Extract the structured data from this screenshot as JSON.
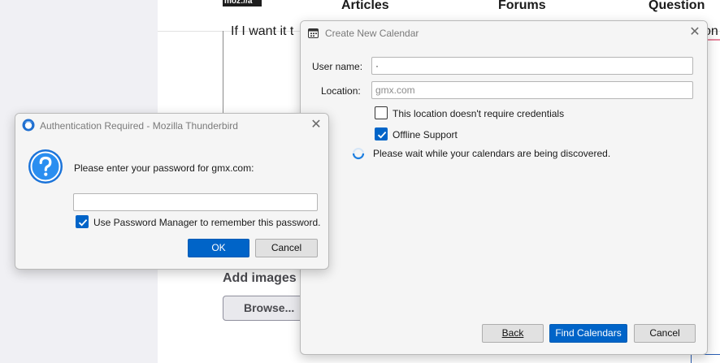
{
  "background": {
    "logo_text": "moz://a",
    "nav": [
      "Articles",
      "Forums",
      "Question"
    ],
    "text_fragment": "If I want it t",
    "text_fragment_right": "on",
    "add_images_label": "Add images",
    "browse_label": "Browse..."
  },
  "calendar_dialog": {
    "title": "Create New Calendar",
    "username_label": "User name:",
    "username_value": "·",
    "location_label": "Location:",
    "location_placeholder": "gmx.com",
    "no_credentials_label": "This location doesn't require credentials",
    "no_credentials_checked": false,
    "offline_label": "Offline Support",
    "offline_checked": true,
    "status_text": "Please wait while your calendars are being discovered.",
    "back_label": "Back",
    "find_label": "Find Calendars",
    "cancel_label": "Cancel"
  },
  "auth_dialog": {
    "title": "Authentication Required - Mozilla Thunderbird",
    "prompt": "Please enter your password for gmx.com:",
    "password_value": "",
    "remember_label": "Use Password Manager to remember this password.",
    "remember_checked": true,
    "ok_label": "OK",
    "cancel_label": "Cancel"
  },
  "colors": {
    "accent": "#0064c8",
    "info_icon": "#1e88e5"
  }
}
